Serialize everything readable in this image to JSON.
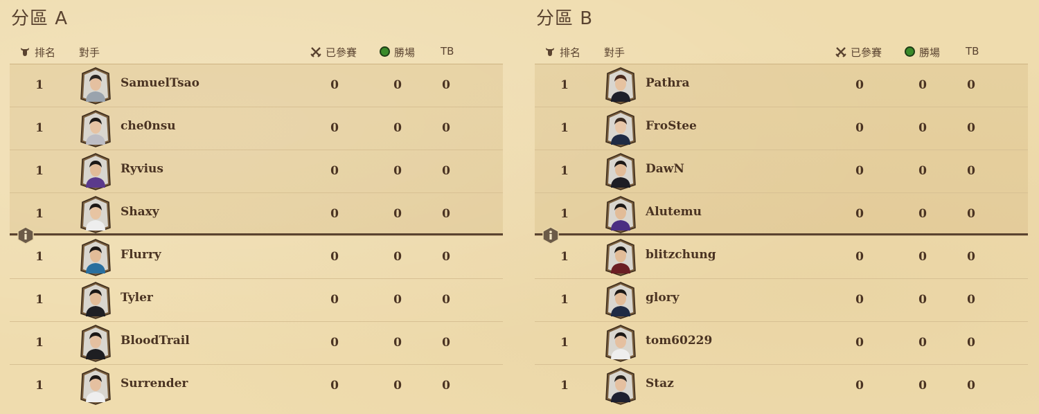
{
  "headers": {
    "rank": "排名",
    "opponent": "對手",
    "played": "已參賽",
    "wins": "勝場",
    "tb": "TB"
  },
  "colors": {
    "background": "#efdcae",
    "text": "#4a3322",
    "cutline": "#5a4330",
    "win_dot": "#3a8a2a"
  },
  "icons": {
    "rank": "bull-head-icon",
    "played": "crossed-swords-icon",
    "wins": "green-dot-icon",
    "info": "info-icon"
  },
  "group_a": {
    "title": "分區 A",
    "rows": [
      {
        "rank": "1",
        "name": "SamuelTsao",
        "played": "0",
        "wins": "0",
        "tb": "0",
        "jersey": "#9aa3ad",
        "skin": "#e5c0a0",
        "hair": "#2a2522"
      },
      {
        "rank": "1",
        "name": "che0nsu",
        "played": "0",
        "wins": "0",
        "tb": "0",
        "jersey": "#bdbdc4",
        "skin": "#e6c3a3",
        "hair": "#1e1a18"
      },
      {
        "rank": "1",
        "name": "Ryvius",
        "played": "0",
        "wins": "0",
        "tb": "0",
        "jersey": "#5b3a8c",
        "skin": "#e2bc98",
        "hair": "#1c1816"
      },
      {
        "rank": "1",
        "name": "Shaxy",
        "played": "0",
        "wins": "0",
        "tb": "0",
        "jersey": "#eeeeee",
        "skin": "#e7c4a2",
        "hair": "#1c1816"
      },
      {
        "rank": "1",
        "name": "Flurry",
        "played": "0",
        "wins": "0",
        "tb": "0",
        "jersey": "#2a6f9e",
        "skin": "#e2bc98",
        "hair": "#1c1816"
      },
      {
        "rank": "1",
        "name": "Tyler",
        "played": "0",
        "wins": "0",
        "tb": "0",
        "jersey": "#1f1f24",
        "skin": "#e2bc98",
        "hair": "#1c1816"
      },
      {
        "rank": "1",
        "name": "BloodTrail",
        "played": "0",
        "wins": "0",
        "tb": "0",
        "jersey": "#1e1e22",
        "skin": "#e5c0a0",
        "hair": "#1c1816"
      },
      {
        "rank": "1",
        "name": "Surrender",
        "played": "0",
        "wins": "0",
        "tb": "0",
        "jersey": "#eeeeee",
        "skin": "#e5c0a0",
        "hair": "#1c1816"
      }
    ]
  },
  "group_b": {
    "title": "分區 B",
    "rows": [
      {
        "rank": "1",
        "name": "Pathra",
        "played": "0",
        "wins": "0",
        "tb": "0",
        "jersey": "#1d1f2a",
        "skin": "#e6c2a0",
        "hair": "#4a2a1e"
      },
      {
        "rank": "1",
        "name": "FroStee",
        "played": "0",
        "wins": "0",
        "tb": "0",
        "jersey": "#1e2a44",
        "skin": "#e8c7a8",
        "hair": "#3a2a20"
      },
      {
        "rank": "1",
        "name": "DawN",
        "played": "0",
        "wins": "0",
        "tb": "0",
        "jersey": "#1d1d24",
        "skin": "#e2bc98",
        "hair": "#1c1816"
      },
      {
        "rank": "1",
        "name": "Alutemu",
        "played": "0",
        "wins": "0",
        "tb": "0",
        "jersey": "#4a2e82",
        "skin": "#e2bc98",
        "hair": "#1c1816"
      },
      {
        "rank": "1",
        "name": "blitzchung",
        "played": "0",
        "wins": "0",
        "tb": "0",
        "jersey": "#6b1e24",
        "skin": "#e2bc98",
        "hair": "#1c1816"
      },
      {
        "rank": "1",
        "name": "glory",
        "played": "0",
        "wins": "0",
        "tb": "0",
        "jersey": "#1e2a44",
        "skin": "#e2bc98",
        "hair": "#1c1816"
      },
      {
        "rank": "1",
        "name": "tom60229",
        "played": "0",
        "wins": "0",
        "tb": "0",
        "jersey": "#eeeeee",
        "skin": "#e5c0a0",
        "hair": "#1c1816"
      },
      {
        "rank": "1",
        "name": "Staz",
        "played": "0",
        "wins": "0",
        "tb": "0",
        "jersey": "#1e2030",
        "skin": "#e5c0a0",
        "hair": "#2a2420"
      }
    ]
  }
}
